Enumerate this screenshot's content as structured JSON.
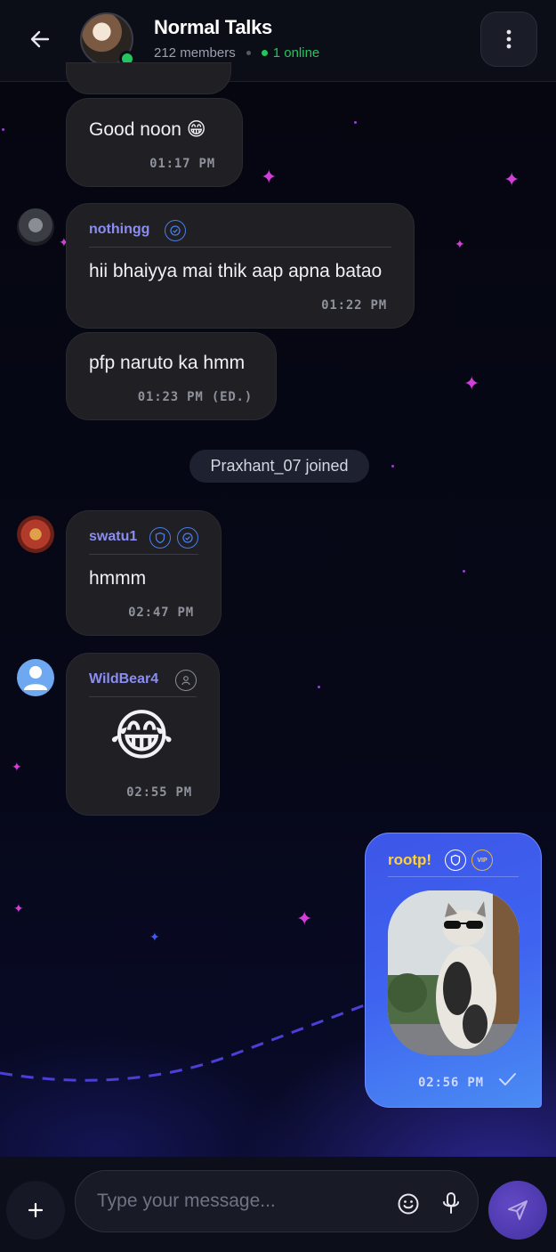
{
  "header": {
    "title": "Normal Talks",
    "members": "212 members",
    "online": "1 online"
  },
  "messages": [
    {
      "id": "m1",
      "text": "Good noon 😁",
      "time": "01:17 PM"
    },
    {
      "id": "m2",
      "sender": "nothingg",
      "text": "hii bhaiyya mai thik aap apna batao",
      "time": "01:22 PM"
    },
    {
      "id": "m3",
      "text": "pfp naruto ka hmm",
      "time": "01:23 PM (ED.)"
    },
    {
      "id": "m4",
      "sender": "swatu1",
      "text": "hmmm",
      "time": "02:47 PM"
    },
    {
      "id": "m5",
      "sender": "WildBear4",
      "text": "😂",
      "time": "02:55 PM"
    },
    {
      "id": "m6",
      "sender": "rootp!",
      "badge": "VIP",
      "time": "02:56 PM"
    }
  ],
  "system": {
    "joined": "Praxhant_07 joined"
  },
  "composer": {
    "placeholder": "Type your message..."
  },
  "colors": {
    "accent": "#3f63f0",
    "online": "#22c55e",
    "sender_name": "#8b8df0",
    "vip_name": "#ffd23a"
  }
}
